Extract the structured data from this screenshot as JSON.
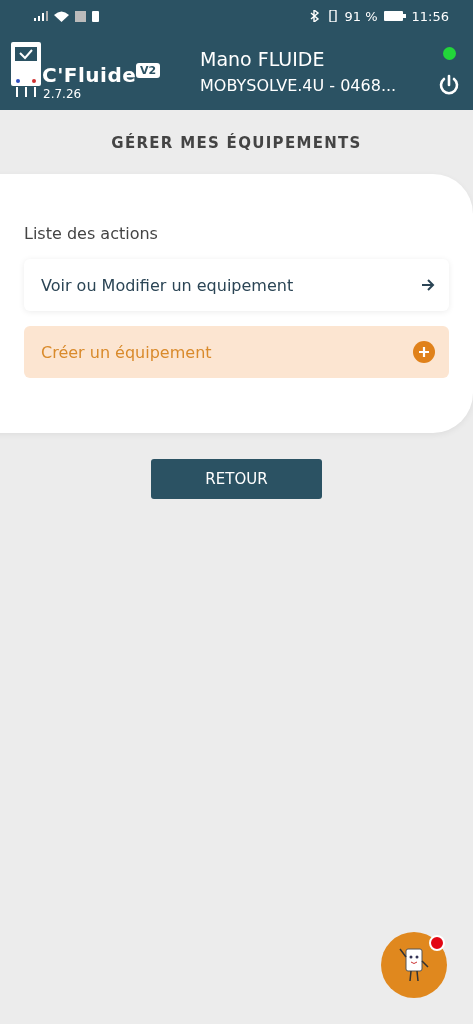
{
  "status_bar": {
    "battery": "91 %",
    "time": "11:56"
  },
  "header": {
    "app_name": "C'Fluide",
    "badge": "V2",
    "version": "2.7.26",
    "device_name": "Mano FLUIDE",
    "device_id": "MOBYSOLVE.4U - 0468...",
    "connected": true
  },
  "page_title": "GÉRER MES ÉQUIPEMENTS",
  "card": {
    "heading": "Liste des actions",
    "actions": [
      {
        "kind": "link",
        "label": "Voir ou Modifier un equipement"
      },
      {
        "kind": "create",
        "label": "Créer un équipement"
      }
    ]
  },
  "back_button": "RETOUR",
  "assistant": {
    "notification": true
  }
}
